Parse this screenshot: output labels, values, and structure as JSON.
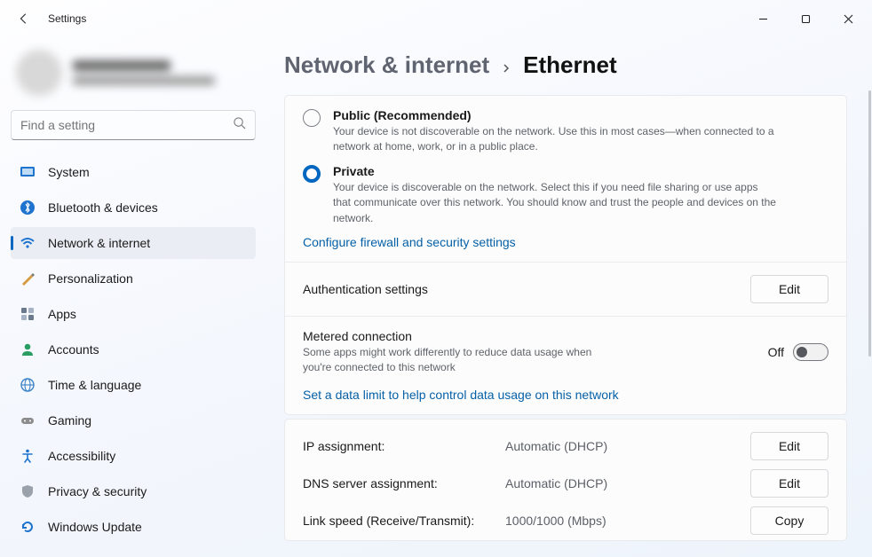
{
  "titlebar": {
    "app_title": "Settings"
  },
  "search": {
    "placeholder": "Find a setting"
  },
  "sidebar": {
    "items": [
      {
        "label": "System"
      },
      {
        "label": "Bluetooth & devices"
      },
      {
        "label": "Network & internet"
      },
      {
        "label": "Personalization"
      },
      {
        "label": "Apps"
      },
      {
        "label": "Accounts"
      },
      {
        "label": "Time & language"
      },
      {
        "label": "Gaming"
      },
      {
        "label": "Accessibility"
      },
      {
        "label": "Privacy & security"
      },
      {
        "label": "Windows Update"
      }
    ]
  },
  "breadcrumb": {
    "parent": "Network & internet",
    "current": "Ethernet"
  },
  "profile": {
    "public": {
      "title": "Public (Recommended)",
      "desc": "Your device is not discoverable on the network. Use this in most cases—when connected to a network at home, work, or in a public place."
    },
    "private": {
      "title": "Private",
      "desc": "Your device is discoverable on the network. Select this if you need file sharing or use apps that communicate over this network. You should know and trust the people and devices on the network."
    },
    "firewall_link": "Configure firewall and security settings"
  },
  "auth": {
    "title": "Authentication settings",
    "button": "Edit"
  },
  "metered": {
    "title": "Metered connection",
    "desc": "Some apps might work differently to reduce data usage when you're connected to this network",
    "state_label": "Off",
    "limit_link": "Set a data limit to help control data usage on this network"
  },
  "details": {
    "rows": [
      {
        "key": "IP assignment:",
        "value": "Automatic (DHCP)",
        "button": "Edit"
      },
      {
        "key": "DNS server assignment:",
        "value": "Automatic (DHCP)",
        "button": "Edit"
      },
      {
        "key": "Link speed (Receive/Transmit):",
        "value": "1000/1000 (Mbps)",
        "button": "Copy"
      }
    ]
  }
}
